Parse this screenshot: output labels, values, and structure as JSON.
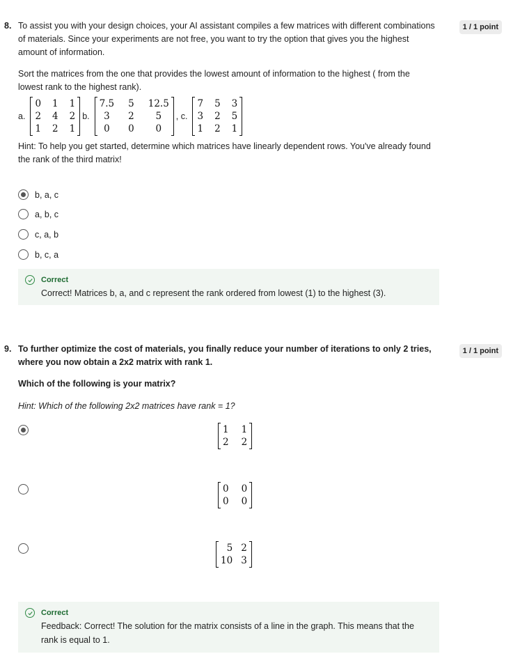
{
  "q8": {
    "number": "8.",
    "points": "1 / 1 point",
    "intro": "To assist you with your design choices, your AI assistant compiles a few matrices with different combinations of materials. Since your experiments are not free, you want to try the option that gives you the highest amount of information.",
    "instruction": "Sort the matrices from the one that provides the lowest amount of information to the highest ( from the lowest rank to the highest rank).",
    "matrix_labels": {
      "a": "a.",
      "b": "b.",
      "c": ", c."
    },
    "matrix_a": [
      "0",
      "1",
      "1",
      "2",
      "4",
      "2",
      "1",
      "2",
      "1"
    ],
    "matrix_b": [
      "7.5",
      "5",
      "12.5",
      "3",
      "2",
      "5",
      "0",
      "0",
      "0"
    ],
    "matrix_c": [
      "7",
      "5",
      "3",
      "3",
      "2",
      "5",
      "1",
      "2",
      "1"
    ],
    "hint": "Hint: To help you get started, determine which matrices have linearly dependent rows. You've already found the rank of the third matrix!",
    "options": [
      {
        "label": "b, a, c",
        "selected": true
      },
      {
        "label": "a, b, c",
        "selected": false
      },
      {
        "label": "c, a, b",
        "selected": false
      },
      {
        "label": "b, c, a",
        "selected": false
      }
    ],
    "feedback": {
      "status": "Correct",
      "text": "Correct! Matrices b, a, and c represent the rank ordered from lowest (1) to the highest (3)."
    }
  },
  "q9": {
    "number": "9.",
    "points": "1 / 1 point",
    "intro": "To further optimize the cost of materials, you finally reduce your number of iterations to only 2 tries, where you now obtain a 2x2 matrix with rank 1.",
    "question": "Which of the following is your matrix?",
    "hint": "Hint: Which of the following 2x2 matrices have rank  = 1?",
    "options": [
      {
        "matrix": [
          "1",
          "1",
          "2",
          "2"
        ],
        "selected": true
      },
      {
        "matrix": [
          "0",
          "0",
          "0",
          "0"
        ],
        "selected": false
      },
      {
        "matrix": [
          "5",
          "2",
          "10",
          "3"
        ],
        "selected": false
      }
    ],
    "feedback": {
      "status": "Correct",
      "text": "Feedback: Correct! The solution for the matrix consists of a line in the graph. This means that the rank is equal to 1."
    }
  },
  "colors": {
    "correct_green": "#1e6b32",
    "feedback_bg": "#f1f6f2",
    "badge_bg": "#ececec"
  },
  "icons": {
    "radio": "radio-button",
    "check": "check-circle-icon"
  }
}
